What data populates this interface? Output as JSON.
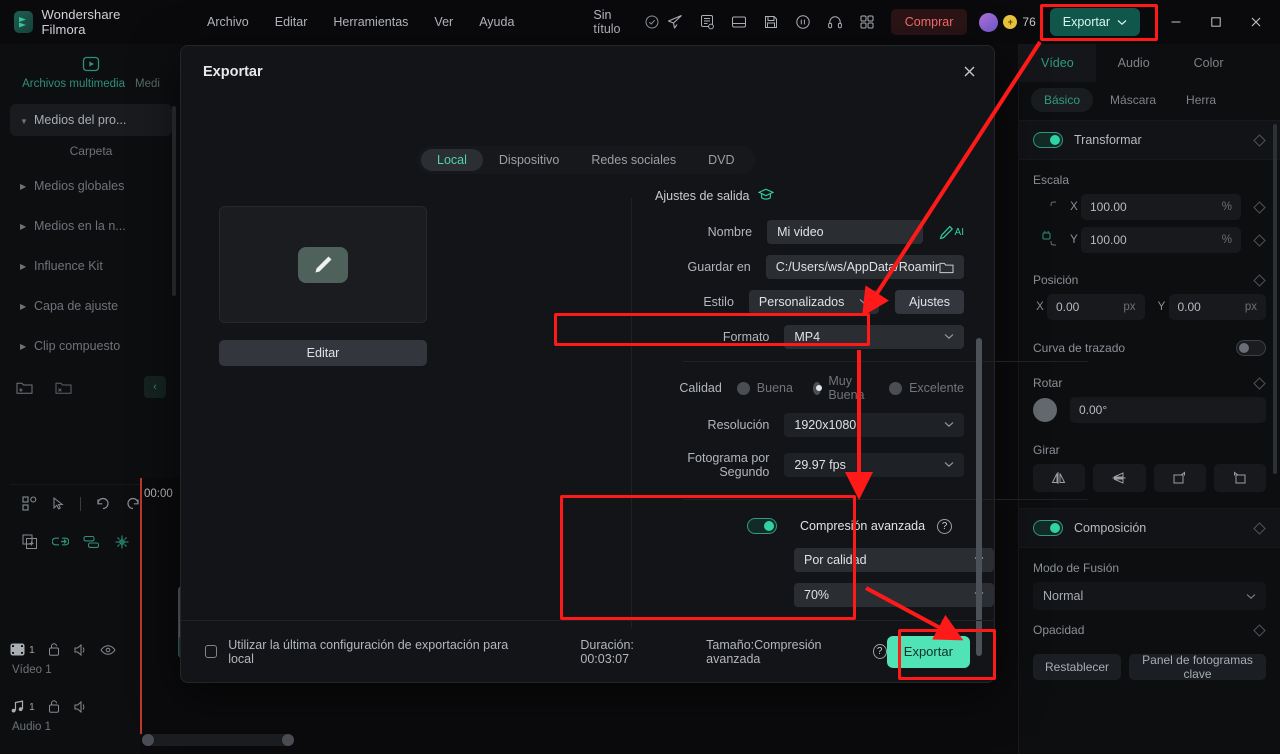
{
  "topbar": {
    "brand": "Wondershare Filmora",
    "menus": [
      "Archivo",
      "Editar",
      "Herramientas",
      "Ver",
      "Ayuda"
    ],
    "doc_title": "Sin título",
    "buy_label": "Comprar",
    "credits": "76",
    "export_label": "Exportar",
    "icons": [
      "send-icon",
      "notes-icon",
      "layout-icon",
      "save-icon",
      "speed-icon",
      "headset-icon",
      "grid-icon"
    ],
    "window_controls": [
      "minimize-icon",
      "maximize-icon",
      "close-icon"
    ]
  },
  "left_panel": {
    "tabs": [
      {
        "label": "Archivos multimedia",
        "active": true
      },
      {
        "label": "Medi",
        "active": false
      }
    ],
    "tree": [
      {
        "label": "Medios del pro...",
        "selected": true,
        "expanded": true
      },
      {
        "label": "Carpeta",
        "selected": false,
        "child": true
      },
      {
        "label": "Medios globales",
        "selected": false,
        "expanded": false
      },
      {
        "label": "Medios en la n...",
        "selected": false,
        "expanded": false
      },
      {
        "label": "Influence Kit",
        "selected": false,
        "expanded": false
      },
      {
        "label": "Capa de ajuste",
        "selected": false,
        "expanded": false
      },
      {
        "label": "Clip compuesto",
        "selected": false,
        "expanded": false
      }
    ],
    "footer_icons": [
      "new-folder-icon",
      "delete-folder-icon",
      "collapse-panel-icon"
    ]
  },
  "timeline": {
    "toolbar_icons": [
      "grid-view-icon",
      "cursor-tool-icon",
      "undo-icon",
      "redo-icon"
    ],
    "toolbar2_icons": [
      "duplicate-icon",
      "link-icon",
      "group-icon",
      "marker-icon"
    ],
    "time_label": "00:00",
    "tracks": [
      {
        "name": "Vídeo 1",
        "number": "1",
        "icons": [
          "film-icon",
          "lock-icon",
          "mute-icon",
          "eye-icon"
        ]
      },
      {
        "name": "Audio 1",
        "number": "1",
        "icons": [
          "music-icon",
          "lock-icon",
          "mute-icon"
        ]
      }
    ]
  },
  "right_panel": {
    "tabs": [
      {
        "label": "Vídeo",
        "active": true
      },
      {
        "label": "Audio",
        "active": false
      },
      {
        "label": "Color",
        "active": false
      }
    ],
    "subtabs": [
      {
        "label": "Básico",
        "active": true
      },
      {
        "label": "Máscara",
        "active": false
      },
      {
        "label": "Herra",
        "active": false
      }
    ],
    "transform": {
      "title": "Transformar",
      "enabled": true,
      "scale_label": "Escala",
      "scale_x": "100.00",
      "scale_y": "100.00",
      "scale_unit": "%",
      "position_label": "Posición",
      "pos_x": "0.00",
      "pos_y": "0.00",
      "pos_unit": "px",
      "axis_x": "X",
      "axis_y": "Y",
      "curve_label": "Curva de trazado",
      "curve_enabled": false,
      "rotate_label": "Rotar",
      "rotate_value": "0.00°",
      "flip_label": "Girar",
      "flip_icons": [
        "flip-horizontal-icon",
        "flip-vertical-icon",
        "rotate-right-icon",
        "rotate-left-icon"
      ]
    },
    "composition": {
      "title": "Composición",
      "enabled": true,
      "blend_label": "Modo de Fusión",
      "blend_value": "Normal",
      "opacity_label": "Opacidad"
    },
    "footer": {
      "reset_label": "Restablecer",
      "keyframe_panel_label": "Panel de fotogramas clave"
    }
  },
  "dialog": {
    "title": "Exportar",
    "tabs": [
      {
        "label": "Local",
        "active": true
      },
      {
        "label": "Dispositivo",
        "active": false
      },
      {
        "label": "Redes sociales",
        "active": false
      },
      {
        "label": "DVD",
        "active": false
      }
    ],
    "preview": {
      "edit_button": "Editar",
      "icon": "edit-pencil-icon"
    },
    "output_settings_label": "Ajustes de salida",
    "fields": [
      {
        "label": "Nombre",
        "value": "Mi video",
        "type": "text",
        "accessory": "ai-pencil-icon"
      },
      {
        "label": "Guardar en",
        "value": "C:/Users/ws/AppData/Roamir",
        "type": "path",
        "accessory": "folder-icon"
      },
      {
        "label": "Estilo",
        "value": "Personalizados",
        "type": "select",
        "accessory_button": "Ajustes"
      },
      {
        "label": "Formato",
        "value": "MP4",
        "type": "select",
        "highlighted": true
      }
    ],
    "quality": {
      "label": "Calidad",
      "options": [
        {
          "label": "Buena",
          "selected": false
        },
        {
          "label": "Muy Buena",
          "selected": true
        },
        {
          "label": "Excelente",
          "selected": false
        }
      ]
    },
    "resolution": {
      "label": "Resolución",
      "value": "1920x1080"
    },
    "framerate": {
      "label": "Fotograma por Segundo",
      "value": "29.97 fps"
    },
    "compression": {
      "label": "Compresión avanzada",
      "enabled": true,
      "mode_value": "Por calidad",
      "level_value": "70%",
      "help_icon": "question-mark-icon"
    },
    "footer": {
      "checkbox_label": "Utilizar la última configuración de exportación para local",
      "checkbox_checked": false,
      "duration": "Duración: 00:03:07",
      "size": "Tamaño:Compresión avanzada",
      "export_button": "Exportar"
    }
  },
  "annotations": {
    "highlight_color": "#ff1a1a",
    "highlighted_regions": [
      "export-top-button",
      "formato-field",
      "compression-block",
      "export-bottom-button"
    ],
    "arrow_count": 3
  },
  "colors": {
    "accent_teal": "#2fd3a5",
    "accent_green_dark": "#11564a",
    "export_button": "#4fe3b5",
    "buy_red": "#ff6b6b",
    "annotation_red": "#ff1a1a",
    "panel_bg": "#0d0e10",
    "dialog_bg": "#131417"
  }
}
